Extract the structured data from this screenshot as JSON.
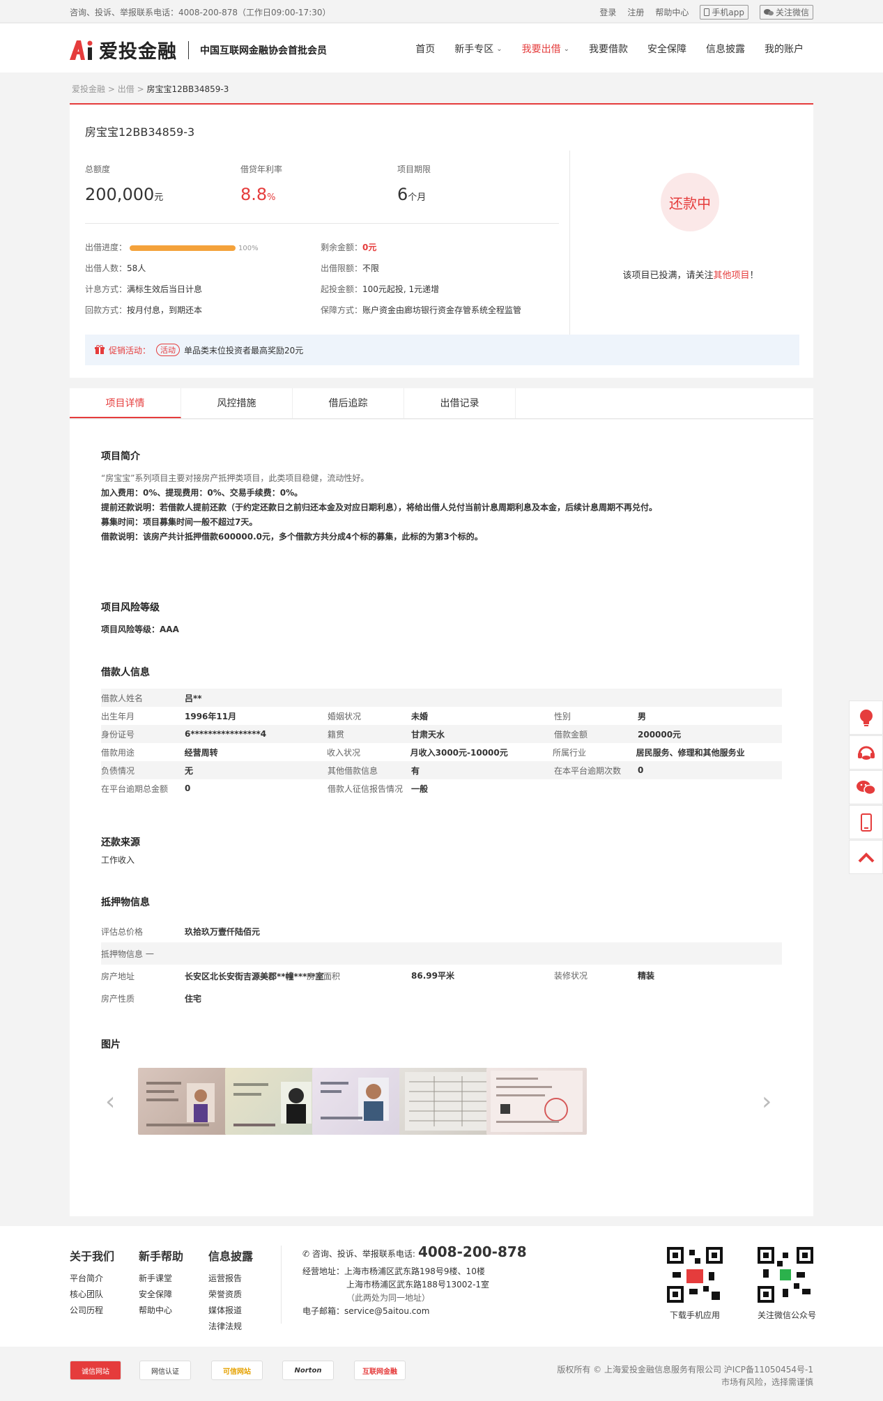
{
  "topbar": {
    "contact": "咨询、投诉、举报联系电话：4008-200-878（工作日09:00-17:30）",
    "login": "登录",
    "register": "注册",
    "help": "帮助中心",
    "app": "手机app",
    "wechat": "关注微信"
  },
  "header": {
    "logo_text": "爱投金融",
    "tagline": "中国互联网金融协会首批会员",
    "nav": [
      "首页",
      "新手专区",
      "我要出借",
      "我要借款",
      "安全保障",
      "信息披露",
      "我的账户"
    ]
  },
  "breadcrumb": {
    "home": "爱投金融",
    "sep": ">",
    "level2": "出借",
    "current": "房宝宝12BB34859-3"
  },
  "project": {
    "name": "房宝宝12BB34859-3",
    "total_label": "总额度",
    "total_value": "200,000",
    "total_unit": "元",
    "rate_label": "借贷年利率",
    "rate_value": "8.8",
    "rate_unit": "%",
    "term_label": "项目期限",
    "term_value": "6",
    "term_unit": "个月",
    "progress_label": "出借进度：",
    "progress_percent": 100,
    "progress_text": "100%",
    "remain_label": "剩余金额：",
    "remain_value": "0元",
    "investors_label": "出借人数：",
    "investors_value": "58人",
    "limit_label": "出借限额：",
    "limit_value": "不限",
    "interest_label": "计息方式：",
    "interest_value": "满标生效后当日计息",
    "min_label": "起投金额：",
    "min_value": "100元起投, 1元递增",
    "repay_label": "回款方式：",
    "repay_value": "按月付息，到期还本",
    "guarantee_label": "保障方式：",
    "guarantee_value": "账户资金由廊坊银行资金存管系统全程监管",
    "status": "还款中",
    "status_note_pre": "该项目已投满，请关注",
    "status_note_link": "其他项目",
    "status_note_post": "！",
    "promo_title": "促销活动：",
    "promo_tag": "活动",
    "promo_text": "单品类末位投资者最高奖励20元"
  },
  "tabs": [
    "项目详情",
    "风控措施",
    "借后追踪",
    "出借记录"
  ],
  "intro": {
    "title": "项目简介",
    "line1": "“房宝宝”系列项目主要对接房产抵押类项目，此类项目稳健，流动性好。",
    "line2": "加入费用：0%、提现费用：0%、交易手续费：0%。",
    "line3": "提前还款说明：若借款人提前还款（于约定还款日之前归还本金及对应日期利息），将给出借人兑付当前计息周期利息及本金，后续计息周期不再兑付。",
    "line4": "募集时间：项目募集时间一般不超过7天。",
    "line5": "借款说明：该房产共计抵押借款600000.0元，多个借款方共分成4个标的募集，此标的为第3个标的。"
  },
  "risk": {
    "title": "项目风险等级",
    "text": "项目风险等级：AAA"
  },
  "borrower": {
    "title": "借款人信息",
    "name_k": "借款人姓名",
    "name_v": "吕**",
    "rows": [
      [
        "出生年月",
        "1996年11月",
        "婚姻状况",
        "未婚",
        "性别",
        "男"
      ],
      [
        "身份证号",
        "6****************4",
        "籍贯",
        "甘肃天水",
        "借款金额",
        "200000元"
      ],
      [
        "借款用途",
        "经营周转",
        "收入状况",
        "月收入3000元-10000元",
        "所属行业",
        "居民服务、修理和其他服务业"
      ],
      [
        "负债情况",
        "无",
        "其他借款信息",
        "有",
        "在本平台逾期次数",
        "0"
      ],
      [
        "在平台逾期总金额",
        "0",
        "借款人征信报告情况",
        "一般",
        "",
        ""
      ]
    ]
  },
  "repay_source": {
    "title": "还款来源",
    "text": "工作收入"
  },
  "collateral": {
    "title": "抵押物信息",
    "eval_k": "评估总价格",
    "eval_v": "玖拾玖万壹仟陆佰元",
    "info_k": "抵押物信息 一",
    "addr_k": "房产地址",
    "addr_v": "长安区北长安街吉源美郡**幢*****室",
    "area_k": "房产面积",
    "area_v": "86.99平米",
    "deco_k": "装修状况",
    "deco_v": "精装",
    "nature_k": "房产性质",
    "nature_v": "住宅"
  },
  "pictures": {
    "title": "图片"
  },
  "footer": {
    "about_title": "关于我们",
    "about": [
      "平台简介",
      "核心团队",
      "公司历程"
    ],
    "newbie_title": "新手帮助",
    "newbie": [
      "新手课堂",
      "安全保障",
      "帮助中心"
    ],
    "info_title": "信息披露",
    "info": [
      "运营报告",
      "荣誉资质",
      "媒体报道",
      "法律法规"
    ],
    "contact_label": "咨询、投诉、举报联系电话:",
    "tel": "4008-200-878",
    "addr_label": "经营地址：",
    "addr1": "上海市杨浦区武东路198号9楼、10楼",
    "addr2": "上海市杨浦区武东路188号13002-1室",
    "addr_note": "（此两处为同一地址）",
    "email_label": "电子邮箱：",
    "email": "service@5aitou.com",
    "qr1": "下载手机应用",
    "qr2": "关注微信公众号"
  },
  "bottom": {
    "badges": [
      "诚信网站",
      "网信认证",
      "可信网站",
      "Norton",
      "互联网金融"
    ],
    "copyright": "版权所有 © 上海爱投金融信息服务有限公司 沪ICP备11050454号-1",
    "risk": "市场有风险，选择需谨慎"
  },
  "colors": {
    "brand_red": "#e53c3c",
    "progress": "#f4a23b"
  }
}
